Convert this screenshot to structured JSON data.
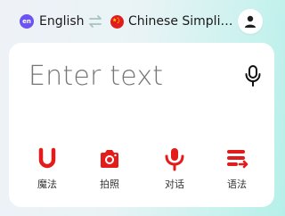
{
  "header": {
    "source_language": "English",
    "source_badge": "en",
    "target_language": "Chinese Simpli…",
    "colors": {
      "badge": "#6c54f0",
      "accent": "#e31b1b"
    }
  },
  "input": {
    "placeholder": "Enter text"
  },
  "tools": [
    {
      "label": "魔法",
      "icon": "magic-icon"
    },
    {
      "label": "拍照",
      "icon": "camera-icon"
    },
    {
      "label": "对话",
      "icon": "conversation-mic-icon"
    },
    {
      "label": "语法",
      "icon": "grammar-icon"
    }
  ]
}
